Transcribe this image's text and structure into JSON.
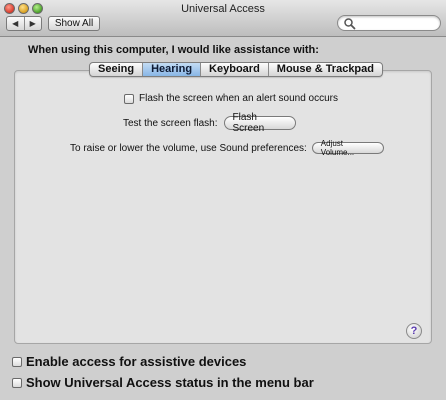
{
  "window": {
    "title": "Universal Access"
  },
  "toolbar": {
    "back_glyph": "◀",
    "forward_glyph": "▶",
    "show_all_label": "Show All",
    "search_placeholder": ""
  },
  "heading": "When using this computer, I would like assistance with:",
  "tabs": [
    {
      "label": "Seeing",
      "active": false
    },
    {
      "label": "Hearing",
      "active": true
    },
    {
      "label": "Keyboard",
      "active": false
    },
    {
      "label": "Mouse & Trackpad",
      "active": false
    }
  ],
  "hearing": {
    "flash_checkbox_label": "Flash the screen when an alert sound occurs",
    "flash_checked": false,
    "test_label": "Test the screen flash:",
    "flash_button_label": "Flash Screen",
    "volume_label": "To raise or lower the volume, use Sound preferences:",
    "adjust_volume_label": "Adjust Volume..."
  },
  "help_glyph": "?",
  "bottom": {
    "assistive_label": "Enable access for assistive devices",
    "assistive_checked": false,
    "status_label": "Show Universal Access status in the menu bar",
    "status_checked": false
  },
  "colors": {
    "accent_tab": "#88b6e6",
    "help_icon": "#5b3bb0"
  }
}
